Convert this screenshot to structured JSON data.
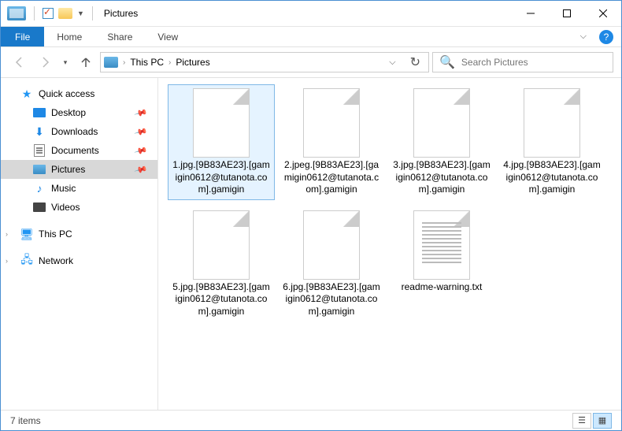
{
  "window": {
    "title": "Pictures"
  },
  "ribbon": {
    "file": "File",
    "tabs": [
      "Home",
      "Share",
      "View"
    ]
  },
  "address": {
    "crumbs": [
      "This PC",
      "Pictures"
    ]
  },
  "search": {
    "placeholder": "Search Pictures"
  },
  "sidebar": {
    "quick_access": "Quick access",
    "items": [
      {
        "label": "Desktop",
        "icon": "desktop",
        "pinned": true
      },
      {
        "label": "Downloads",
        "icon": "download",
        "pinned": true
      },
      {
        "label": "Documents",
        "icon": "document",
        "pinned": true
      },
      {
        "label": "Pictures",
        "icon": "picture",
        "pinned": true,
        "selected": true
      },
      {
        "label": "Music",
        "icon": "music",
        "pinned": false
      },
      {
        "label": "Videos",
        "icon": "video",
        "pinned": false
      }
    ],
    "this_pc": "This PC",
    "network": "Network"
  },
  "files": [
    {
      "name": "1.jpg.[9B83AE23].[gamigin0612@tutanota.com].gamigin",
      "type": "blank",
      "selected": true
    },
    {
      "name": "2.jpeg.[9B83AE23].[gamigin0612@tutanota.com].gamigin",
      "type": "blank"
    },
    {
      "name": "3.jpg.[9B83AE23].[gamigin0612@tutanota.com].gamigin",
      "type": "blank"
    },
    {
      "name": "4.jpg.[9B83AE23].[gamigin0612@tutanota.com].gamigin",
      "type": "blank"
    },
    {
      "name": "5.jpg.[9B83AE23].[gamigin0612@tutanota.com].gamigin",
      "type": "blank"
    },
    {
      "name": "6.jpg.[9B83AE23].[gamigin0612@tutanota.com].gamigin",
      "type": "blank"
    },
    {
      "name": "readme-warning.txt",
      "type": "txt"
    }
  ],
  "status": {
    "count": "7 items"
  }
}
